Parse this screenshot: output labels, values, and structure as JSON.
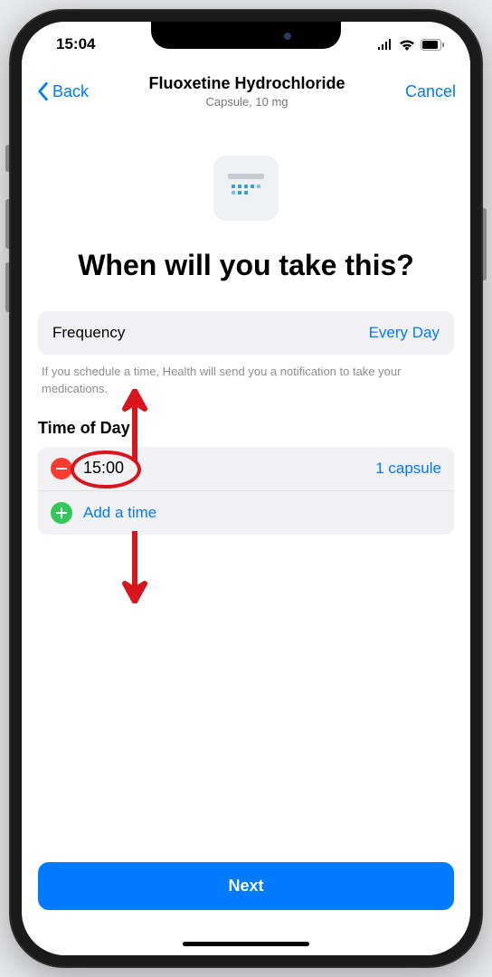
{
  "status_bar": {
    "time": "15:04"
  },
  "nav": {
    "back": "Back",
    "title": "Fluoxetine Hydrochloride",
    "subtitle": "Capsule, 10 mg",
    "cancel": "Cancel"
  },
  "heading": "When will you take this?",
  "frequency": {
    "label": "Frequency",
    "value": "Every Day"
  },
  "hint": "If you schedule a time, Health will send you a notification to take your medications.",
  "time_section": {
    "label": "Time of Day",
    "rows": [
      {
        "time": "15:00",
        "dose": "1 capsule"
      }
    ],
    "add_label": "Add a time"
  },
  "next_button": "Next",
  "colors": {
    "primary": "#007aff",
    "destructive": "#ff3b30",
    "success": "#34c759",
    "annotation": "#d8151c"
  }
}
